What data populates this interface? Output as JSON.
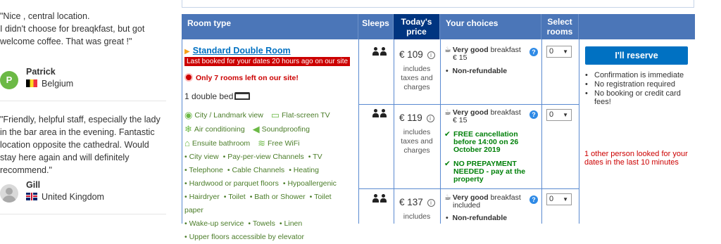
{
  "reviews": [
    {
      "text": "\"Nice , central location.\nI didn't choose for breaqkfast, but got welcome coffee. That was great !\"",
      "initial": "P",
      "name": "Patrick",
      "country": "Belgium"
    },
    {
      "text": "\"Friendly, helpful staff, especially the lady in the bar area in the evening. Fantastic location opposite the cathedral. Would stay here again and will definitely recommend.\"",
      "name": "Gill",
      "country": "United Kingdom"
    }
  ],
  "table": {
    "headers": {
      "room_type": "Room type",
      "sleeps": "Sleeps",
      "todays_price": "Today's price",
      "your_choices": "Your choices",
      "select_rooms": "Select rooms"
    },
    "room": {
      "name": "Standard Double Room",
      "badge": "Last booked for your dates 20 hours ago on our site",
      "scarcity": "Only 7 rooms left on our site!",
      "bed": "1 double bed",
      "facilities_main": [
        "City / Landmark view",
        "Flat-screen TV",
        "Air conditioning",
        "Soundproofing",
        "Ensuite bathroom",
        "Free WiFi"
      ],
      "facilities_small": [
        [
          "City view",
          "Pay-per-view Channels",
          "TV"
        ],
        [
          "Telephone",
          "Cable Channels",
          "Heating"
        ],
        [
          "Hardwood or parquet floors",
          "Hypoallergenic"
        ],
        [
          "Hairdryer",
          "Toilet",
          "Bath or Shower",
          "Toilet paper"
        ],
        [
          "Wake-up service",
          "Towels",
          "Linen"
        ],
        [
          "Upper floors accessible by elevator"
        ]
      ]
    },
    "options": [
      {
        "price": "€ 109",
        "price_note": "includes taxes and charges",
        "breakfast_rating": "Very good",
        "breakfast_word": "breakfast",
        "breakfast_price": "€ 15",
        "policy": "Non-refundable",
        "select_value": "0"
      },
      {
        "price": "€ 119",
        "price_note": "includes taxes and charges",
        "breakfast_rating": "Very good",
        "breakfast_word": "breakfast",
        "breakfast_price": "€ 15",
        "free_cancel": "FREE cancellation before 14:00 on 26 October 2019",
        "no_prepay": "NO PREPAYMENT NEEDED - pay at the property",
        "select_value": "0"
      },
      {
        "price": "€ 137",
        "price_note": "includes",
        "breakfast_rating": "Very good",
        "breakfast_word": "breakfast",
        "breakfast_price": "included",
        "policy": "Non-refundable",
        "select_value": "0"
      }
    ],
    "reserve": {
      "button": "I'll reserve",
      "bullets": [
        "Confirmation is immediate",
        "No registration required",
        "No booking or credit card fees!"
      ],
      "looked": "1 other person looked for your dates in the last 10 minutes"
    }
  },
  "colors": {
    "header_blue": "#4b76b8",
    "header_dark": "#003580",
    "link_blue": "#0071c2",
    "red": "#cc0000",
    "green": "#008009"
  }
}
